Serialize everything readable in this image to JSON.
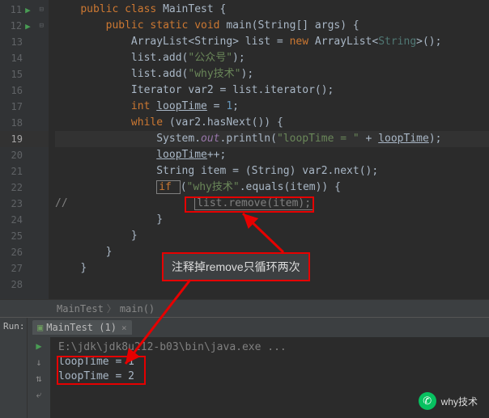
{
  "lines": [
    {
      "n": "11",
      "run": true,
      "fold": "⊟"
    },
    {
      "n": "12",
      "run": true,
      "fold": "⊟"
    },
    {
      "n": "13"
    },
    {
      "n": "14"
    },
    {
      "n": "15"
    },
    {
      "n": "16"
    },
    {
      "n": "17"
    },
    {
      "n": "18"
    },
    {
      "n": "19",
      "hl": true
    },
    {
      "n": "20"
    },
    {
      "n": "21"
    },
    {
      "n": "22"
    },
    {
      "n": "23"
    },
    {
      "n": "24"
    },
    {
      "n": "25"
    },
    {
      "n": "26"
    },
    {
      "n": "27"
    },
    {
      "n": "28",
      "fold": ""
    }
  ],
  "code": {
    "l11": {
      "indent": "    ",
      "kw1": "public class ",
      "name": "MainTest {"
    },
    "l12": {
      "indent": "        ",
      "kw1": "public static void ",
      "name": "main",
      "args": "(String[] args) {"
    },
    "l13": {
      "indent": "            ",
      "t": "ArrayList<String> list = ",
      "kw": "new ",
      "rest": "ArrayList<",
      "gen": "String",
      "rest2": ">();"
    },
    "l14": {
      "indent": "            ",
      "t": "list.add(",
      "s": "\"公众号\"",
      "r": ");"
    },
    "l15": {
      "indent": "            ",
      "t": "list.add(",
      "s": "\"why技术\"",
      "r": ");"
    },
    "l16": {
      "indent": "            ",
      "t": "Iterator var2 = list.iterator();"
    },
    "l17": {
      "indent": "            ",
      "kw": "int ",
      "v": "loopTime",
      "rest": " = ",
      "num": "1",
      "semi": ";"
    },
    "l18": {
      "indent": "            ",
      "kw": "while ",
      "rest": "(var2.hasNext()) {"
    },
    "l19": {
      "indent": "                ",
      "t": "System.",
      "out": "out",
      "p": ".println(",
      "s": "\"loopTime = \"",
      "plus": " + ",
      "v": "loopTime",
      "r": ");"
    },
    "l20": {
      "indent": "                ",
      "v": "loopTime",
      "r": "++;"
    },
    "l21": {
      "indent": "                ",
      "t": "String item = (String) var2.next();"
    },
    "l22": {
      "indent": "                ",
      "kw": "if ",
      "p": "(",
      "s": "\"why技术\"",
      "rest": ".equals(item)) {"
    },
    "l23": {
      "indent": "",
      "c": "//",
      "pad": "                    ",
      "boxed": "list.remove(item);"
    },
    "l24": {
      "indent": "                ",
      "t": "}"
    },
    "l25": {
      "indent": "            ",
      "t": "}"
    },
    "l26": {
      "indent": "        ",
      "t": "}"
    },
    "l27": {
      "indent": "    ",
      "t": "}"
    }
  },
  "breadcrumb": {
    "c1": "MainTest",
    "c2": "main()"
  },
  "run": {
    "label": "Run:",
    "tab": "MainTest (1)",
    "cmd": "E:\\jdk\\jdk8u212-b03\\bin\\java.exe ...",
    "out1": "loopTime = 1",
    "out2": "loopTime = 2"
  },
  "annotation": "注释掉remove只循环两次",
  "watermark": "why技术"
}
